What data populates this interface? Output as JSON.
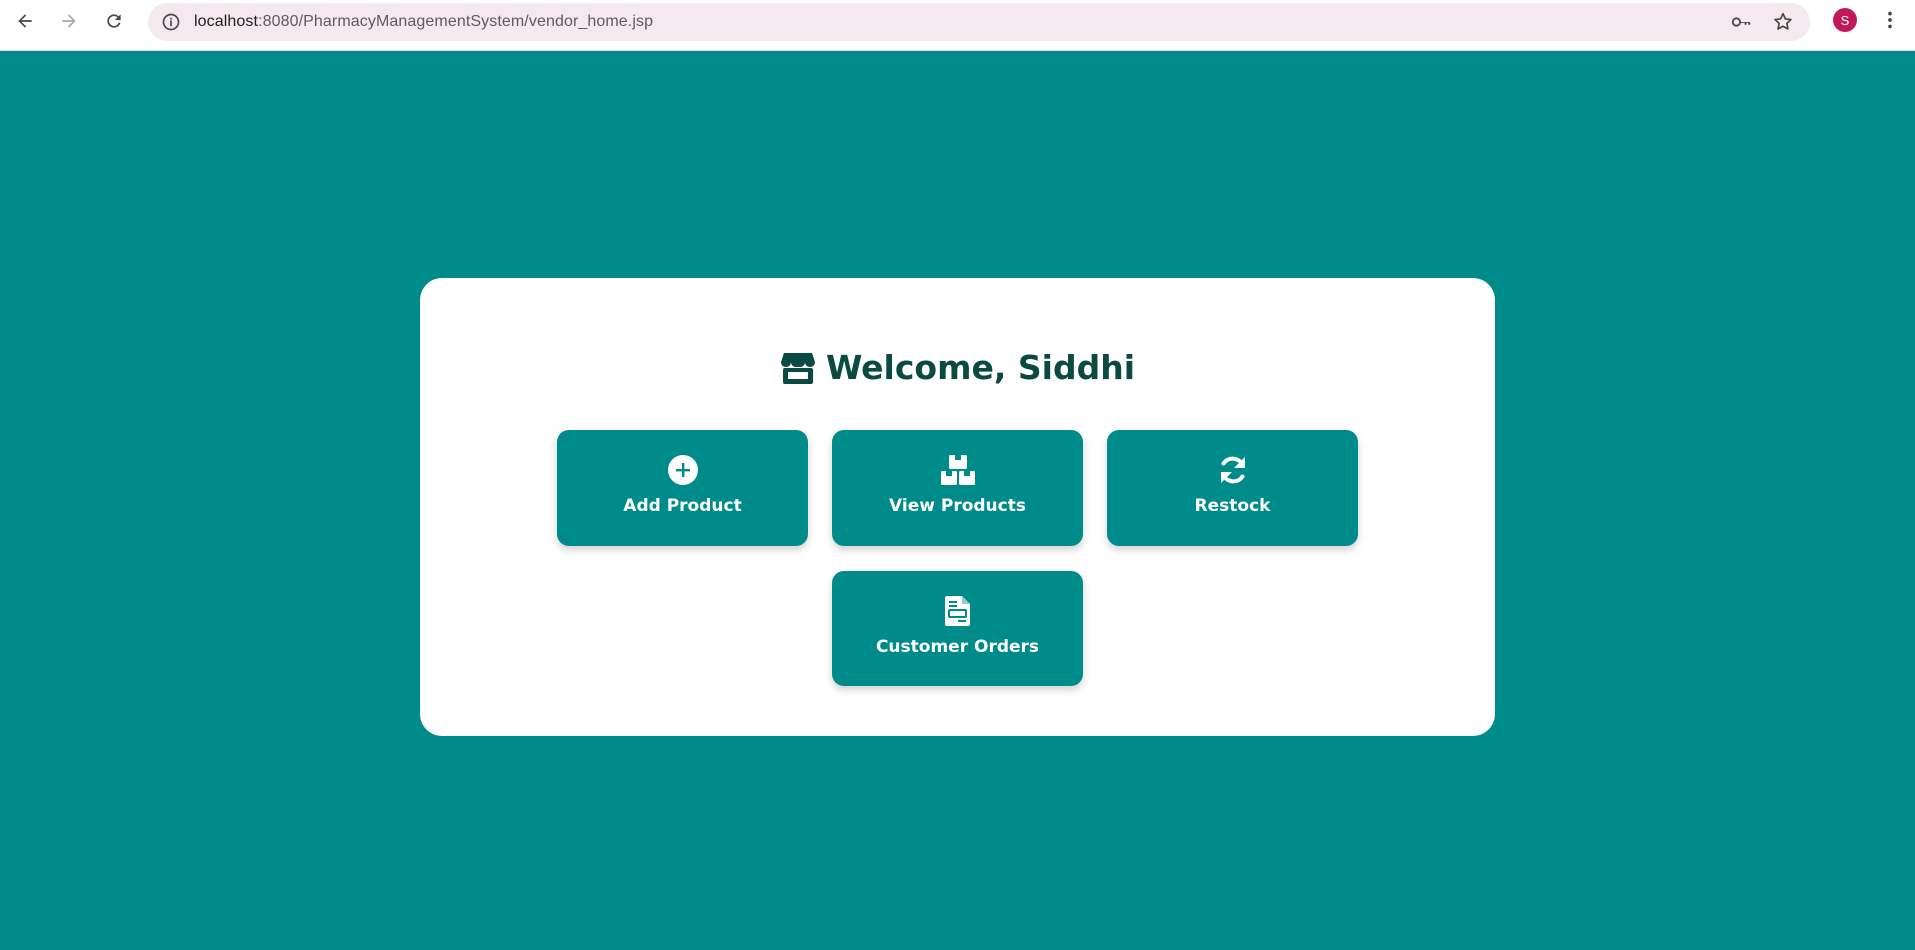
{
  "browser": {
    "url_host": "localhost",
    "url_rest": ":8080/PharmacyManagementSystem/vendor_home.jsp",
    "avatar_letter": "S",
    "avatar_color": "#c2185b"
  },
  "page": {
    "welcome_title": "Welcome, Siddhi",
    "background_color": "#008b8b",
    "title_color": "#0b4a40"
  },
  "actions": [
    {
      "label": "Add Product",
      "icon": "plus-circle-icon"
    },
    {
      "label": "View Products",
      "icon": "boxes-icon"
    },
    {
      "label": "Restock",
      "icon": "refresh-icon"
    },
    {
      "label": "Customer Orders",
      "icon": "invoice-icon"
    }
  ]
}
